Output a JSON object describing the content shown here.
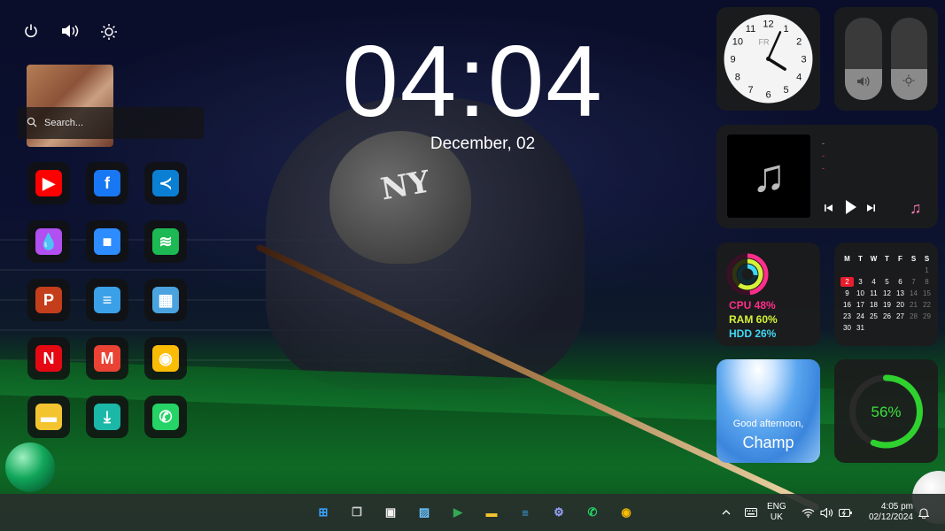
{
  "system": {
    "power_icon": "power-icon",
    "volume_icon": "speaker-icon",
    "brightness_icon": "brightness-icon"
  },
  "search": {
    "placeholder": "Search..."
  },
  "clock": {
    "time": "04:04",
    "date": "December, 02"
  },
  "apps": [
    {
      "name": "YouTube",
      "color": "#ff0000",
      "glyph": "▶"
    },
    {
      "name": "Facebook",
      "color": "#1877f2",
      "glyph": "f"
    },
    {
      "name": "Visual Studio Code",
      "color": "#0a7fd4",
      "glyph": "≺"
    },
    {
      "name": "Paint",
      "color": "#b14ff0",
      "glyph": "💧"
    },
    {
      "name": "Zoom",
      "color": "#2d8cff",
      "glyph": "■"
    },
    {
      "name": "Spotify",
      "color": "#1db954",
      "glyph": "≋"
    },
    {
      "name": "PowerPoint",
      "color": "#c43e1c",
      "glyph": "P"
    },
    {
      "name": "Notepad",
      "color": "#3aa1e8",
      "glyph": "≡"
    },
    {
      "name": "Calculator",
      "color": "#4aa3df",
      "glyph": "▦"
    },
    {
      "name": "Netflix",
      "color": "#e50914",
      "glyph": "N"
    },
    {
      "name": "Gmail",
      "color": "#ea4335",
      "glyph": "M"
    },
    {
      "name": "Chrome",
      "color": "#fbbc05",
      "glyph": "◉"
    },
    {
      "name": "File Explorer",
      "color": "#f4c430",
      "glyph": "▬"
    },
    {
      "name": "Downloads",
      "color": "#1bb8a8",
      "glyph": "⤓"
    },
    {
      "name": "WhatsApp",
      "color": "#25d366",
      "glyph": "✆"
    }
  ],
  "analog_clock": {
    "numbers": [
      "12",
      "1",
      "2",
      "3",
      "4",
      "5",
      "6",
      "7",
      "8",
      "9",
      "10",
      "11"
    ],
    "day": "FR",
    "hour": 4,
    "minute": 4
  },
  "toggles": {
    "volume_level": 0.38,
    "brightness_level": 0.38,
    "volume_icon": "speaker-icon",
    "brightness_icon": "sun-icon"
  },
  "music": {
    "line1": "-",
    "line2": "-",
    "line3": "-",
    "prev_icon": "previous-icon",
    "play_icon": "play-icon",
    "next_icon": "next-icon",
    "app_icon": "music-note-icon"
  },
  "stats": {
    "cpu": "CPU 48%",
    "ram": "RAM 60%",
    "hdd": "HDD 26%",
    "cpu_color": "#ff2e8a",
    "ram_color": "#d6f23a",
    "hdd_color": "#3ed8f5"
  },
  "calendar": {
    "headers": [
      "M",
      "T",
      "W",
      "T",
      "F",
      "S",
      "S"
    ],
    "days": [
      {
        "d": "",
        "c": ""
      },
      {
        "d": "",
        "c": ""
      },
      {
        "d": "",
        "c": ""
      },
      {
        "d": "",
        "c": ""
      },
      {
        "d": "",
        "c": ""
      },
      {
        "d": "",
        "c": ""
      },
      {
        "d": "1",
        "c": "dim"
      },
      {
        "d": "2",
        "c": "today"
      },
      {
        "d": "3",
        "c": ""
      },
      {
        "d": "4",
        "c": ""
      },
      {
        "d": "5",
        "c": ""
      },
      {
        "d": "6",
        "c": ""
      },
      {
        "d": "7",
        "c": "dim"
      },
      {
        "d": "8",
        "c": "dim"
      },
      {
        "d": "9",
        "c": ""
      },
      {
        "d": "10",
        "c": ""
      },
      {
        "d": "11",
        "c": ""
      },
      {
        "d": "12",
        "c": ""
      },
      {
        "d": "13",
        "c": ""
      },
      {
        "d": "14",
        "c": "dim"
      },
      {
        "d": "15",
        "c": "dim"
      },
      {
        "d": "16",
        "c": ""
      },
      {
        "d": "17",
        "c": ""
      },
      {
        "d": "18",
        "c": ""
      },
      {
        "d": "19",
        "c": ""
      },
      {
        "d": "20",
        "c": ""
      },
      {
        "d": "21",
        "c": "dim"
      },
      {
        "d": "22",
        "c": "dim"
      },
      {
        "d": "23",
        "c": ""
      },
      {
        "d": "24",
        "c": ""
      },
      {
        "d": "25",
        "c": ""
      },
      {
        "d": "26",
        "c": ""
      },
      {
        "d": "27",
        "c": ""
      },
      {
        "d": "28",
        "c": "dim"
      },
      {
        "d": "29",
        "c": "dim"
      },
      {
        "d": "30",
        "c": ""
      },
      {
        "d": "31",
        "c": ""
      },
      {
        "d": "",
        "c": ""
      },
      {
        "d": "",
        "c": ""
      },
      {
        "d": "",
        "c": ""
      },
      {
        "d": "",
        "c": ""
      },
      {
        "d": "",
        "c": ""
      }
    ]
  },
  "greeting": {
    "line1": "Good afternoon,",
    "line2": "Champ"
  },
  "ring": {
    "label": "56%",
    "value": 0.56,
    "color": "#2fd12f"
  },
  "taskbar": {
    "apps": [
      {
        "name": "start",
        "color": "#3aa3ff",
        "glyph": "⊞"
      },
      {
        "name": "task-view",
        "color": "#d0d0d0",
        "glyph": "❐"
      },
      {
        "name": "microsoft-store",
        "color": "#f2f2f2",
        "glyph": "▣"
      },
      {
        "name": "photos",
        "color": "#6cc3ff",
        "glyph": "▨"
      },
      {
        "name": "play-store",
        "color": "#34a853",
        "glyph": "▶"
      },
      {
        "name": "file-explorer",
        "color": "#f4c430",
        "glyph": "▬"
      },
      {
        "name": "notepad",
        "color": "#3aa1e8",
        "glyph": "≡"
      },
      {
        "name": "settings",
        "color": "#9aa4ff",
        "glyph": "⚙"
      },
      {
        "name": "whatsapp",
        "color": "#25d366",
        "glyph": "✆"
      },
      {
        "name": "chrome",
        "color": "#fbbc05",
        "glyph": "◉"
      }
    ],
    "lang_top": "ENG",
    "lang_bottom": "UK",
    "time": "4:05 pm",
    "date": "02/12/2024"
  }
}
